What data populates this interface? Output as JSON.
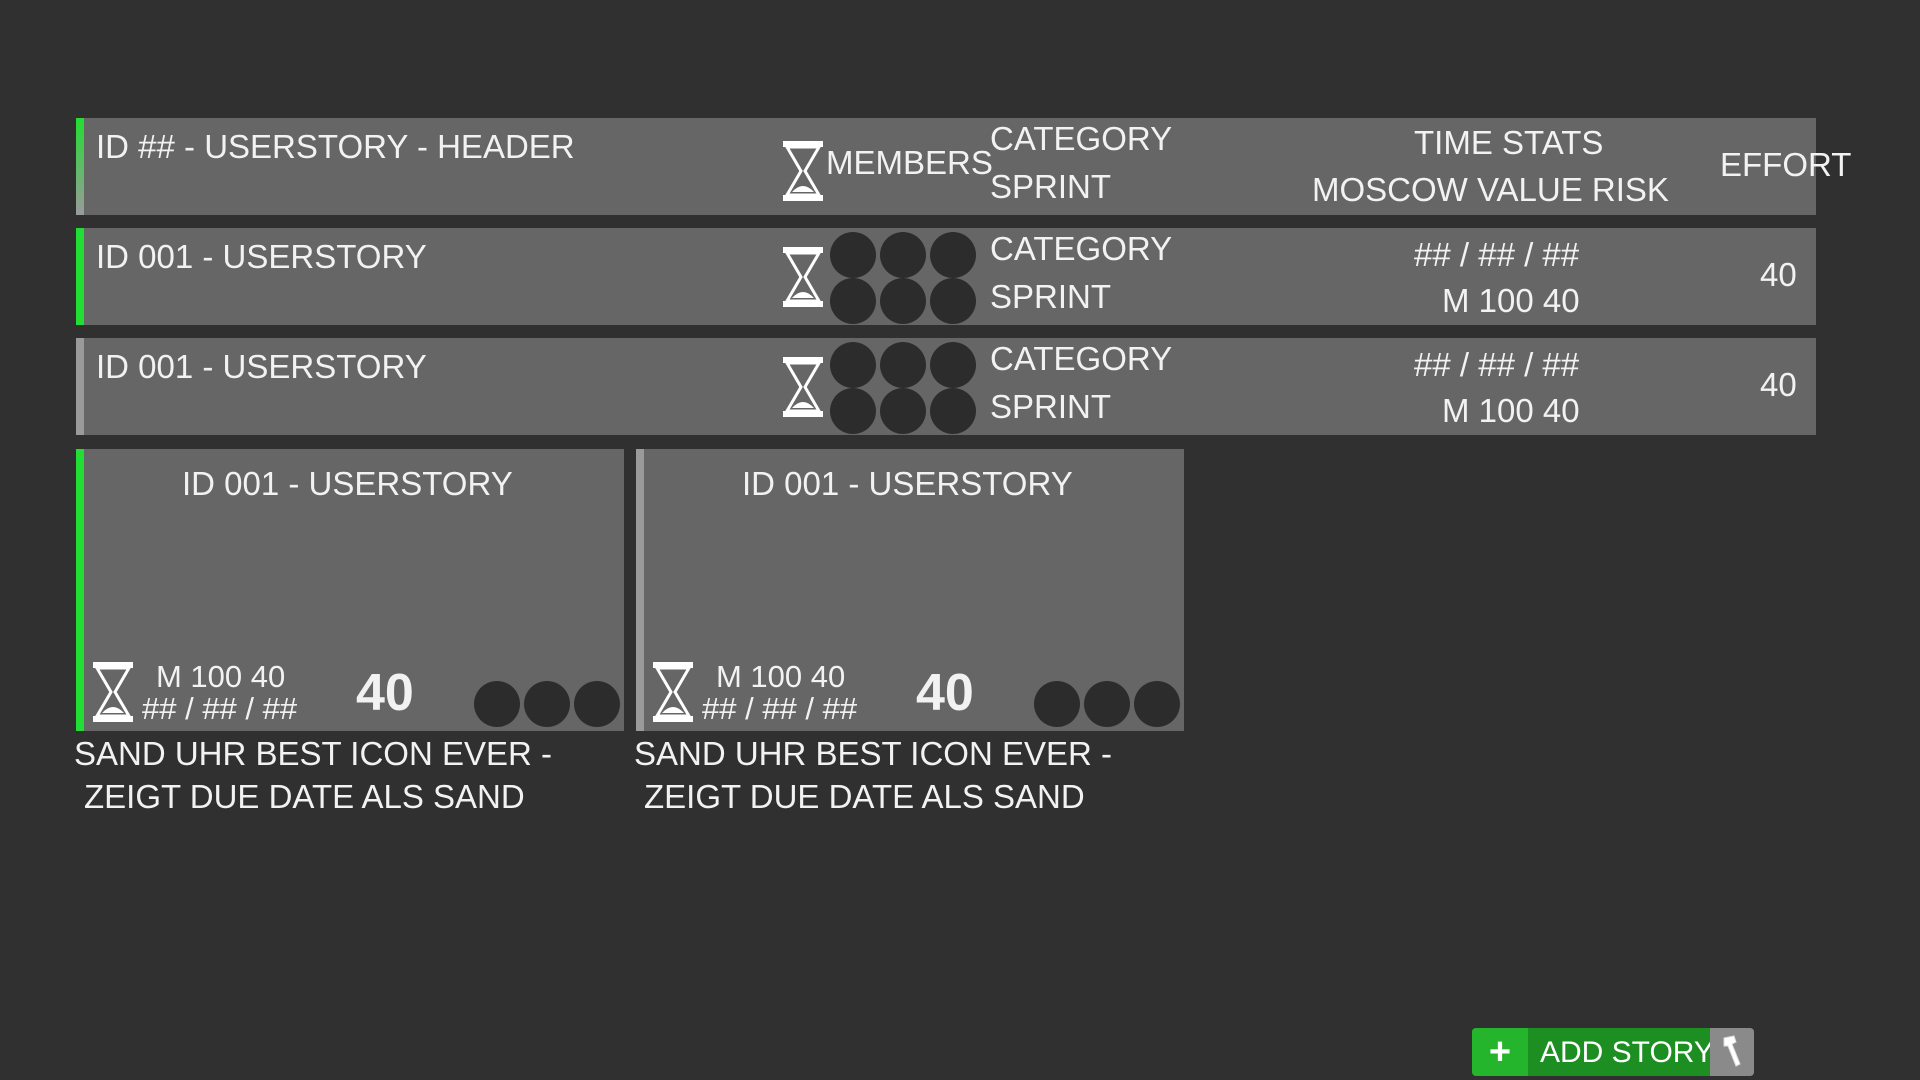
{
  "header_row": {
    "title": "ID ## - USERSTORY - HEADER",
    "members": "MEMBERS",
    "category": "CATEGORY",
    "sprint": "SPRINT",
    "time_stats": "TIME STATS",
    "moscow": "MOSCOW VALUE RISK",
    "effort": "EFFORT"
  },
  "list_rows": [
    {
      "title": "ID 001 - USERSTORY",
      "category": "CATEGORY",
      "sprint": "SPRINT",
      "dates": "## / ## / ##",
      "moscow": "M 100 40",
      "effort": "40",
      "accent": "#22dd33"
    },
    {
      "title": "ID 001 - USERSTORY",
      "category": "CATEGORY",
      "sprint": "SPRINT",
      "dates": "## / ## / ##",
      "moscow": "M 100 40",
      "effort": "40",
      "accent": "#9a9a9a"
    }
  ],
  "cards": [
    {
      "title": "ID 001 - USERSTORY",
      "moscow": "M 100 40",
      "dates": "## / ## / ##",
      "effort": "40",
      "note_line1": "SAND UHR BEST ICON EVER -",
      "note_line2": "ZEIGT DUE DATE ALS SAND",
      "accent": "#22dd33"
    },
    {
      "title": "ID 001 - USERSTORY",
      "moscow": "M 100 40",
      "dates": "## / ## / ##",
      "effort": "40",
      "note_line1": "SAND UHR BEST ICON EVER -",
      "note_line2": "ZEIGT DUE DATE ALS SAND",
      "accent": "#9a9a9a"
    }
  ],
  "add_button": {
    "label": "ADD STORY",
    "plus": "+"
  },
  "icons": {
    "hourglass": "hourglass-icon",
    "member": "member-avatar",
    "tool": "pin-tool-icon"
  },
  "colors": {
    "background": "#303030",
    "row": "#666666",
    "accent_active": "#22dd33",
    "accent_inactive": "#9a9a9a",
    "button": "#1d8f22"
  }
}
